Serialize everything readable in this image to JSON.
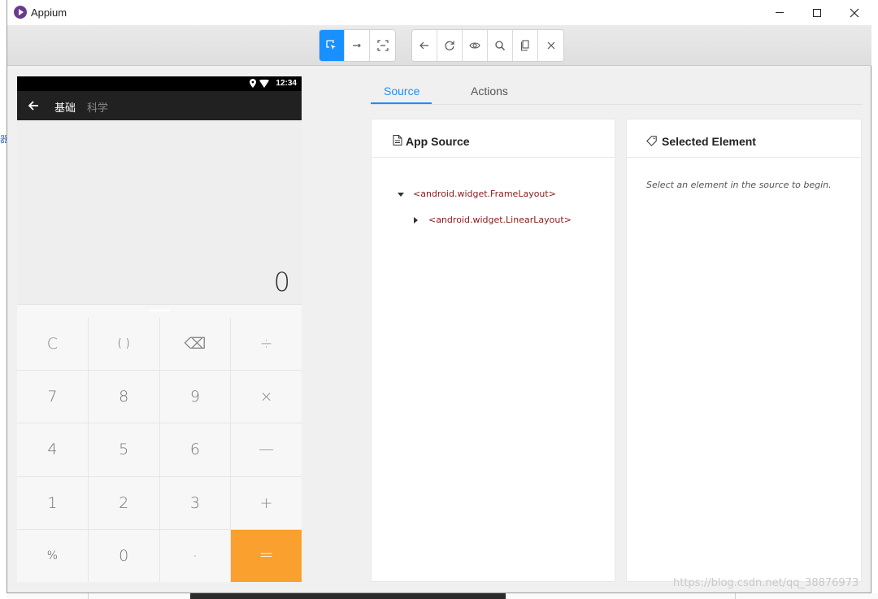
{
  "window": {
    "title": "Appium",
    "minimize_label": "",
    "maximize_label": "",
    "close_label": "✕"
  },
  "background_fragment": "器",
  "toolbar": {
    "group1": [
      {
        "icon": "select-element-icon",
        "active": true
      },
      {
        "icon": "swipe-icon",
        "active": false
      },
      {
        "icon": "tap-coordinates-icon",
        "active": false
      }
    ],
    "group2": [
      {
        "icon": "back-icon"
      },
      {
        "icon": "refresh-icon"
      },
      {
        "icon": "eye-icon"
      },
      {
        "icon": "search-icon"
      },
      {
        "icon": "copy-icon"
      },
      {
        "icon": "close-icon"
      }
    ]
  },
  "device": {
    "status_time": "12:34",
    "tab_basic": "基础",
    "tab_scientific": "科学",
    "display_value": "0",
    "keys": [
      {
        "label": "C",
        "type": "op"
      },
      {
        "label": "( )",
        "type": "small"
      },
      {
        "label": "⌫",
        "type": "op"
      },
      {
        "label": "÷",
        "type": "op"
      },
      {
        "label": "7",
        "type": "num"
      },
      {
        "label": "8",
        "type": "num"
      },
      {
        "label": "9",
        "type": "num"
      },
      {
        "label": "×",
        "type": "op"
      },
      {
        "label": "4",
        "type": "num"
      },
      {
        "label": "5",
        "type": "num"
      },
      {
        "label": "6",
        "type": "num"
      },
      {
        "label": "—",
        "type": "op"
      },
      {
        "label": "1",
        "type": "num"
      },
      {
        "label": "2",
        "type": "num"
      },
      {
        "label": "3",
        "type": "num"
      },
      {
        "label": "+",
        "type": "op"
      },
      {
        "label": "%",
        "type": "small"
      },
      {
        "label": "0",
        "type": "num"
      },
      {
        "label": "·",
        "type": "num"
      },
      {
        "label": "=",
        "type": "equals"
      }
    ]
  },
  "inspector": {
    "tabs": [
      {
        "label": "Source",
        "active": true
      },
      {
        "label": "Actions",
        "active": false
      }
    ],
    "source_panel": {
      "title": "App Source",
      "tree": [
        {
          "label": "<android.widget.FrameLayout>",
          "expanded": true
        },
        {
          "label": "<android.widget.LinearLayout>",
          "expanded": false
        }
      ]
    },
    "selected_panel": {
      "title": "Selected Element",
      "hint": "Select an element in the source to begin."
    }
  },
  "colors": {
    "accent": "#1890ff",
    "equals_key": "#f9a02e",
    "tree_text": "#8b1a1a"
  },
  "watermark": "https://blog.csdn.net/qq_38876973"
}
